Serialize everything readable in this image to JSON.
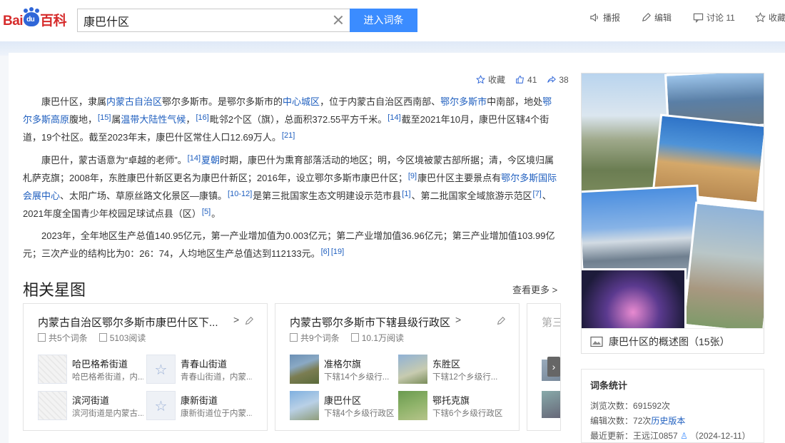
{
  "header": {
    "logo": {
      "bai": "Bai",
      "du": "du",
      "baike": "百科"
    },
    "search_value": "康巴什区",
    "enter_label": "进入词条",
    "tools": [
      {
        "label": "播报",
        "icon": "speaker-icon"
      },
      {
        "label": "编辑",
        "icon": "pencil-icon"
      },
      {
        "label": "讨论 11",
        "icon": "comment-icon"
      },
      {
        "label": "收藏",
        "icon": "star-icon"
      }
    ]
  },
  "actions": {
    "collect": "收藏",
    "likes": "41",
    "shares": "38"
  },
  "article": {
    "p1": [
      {
        "t": "康巴什区，隶属"
      },
      {
        "t": "内蒙古自治区",
        "link": true
      },
      {
        "t": "鄂尔多斯市。是鄂尔多斯市的"
      },
      {
        "t": "中心城区",
        "link": true
      },
      {
        "t": "，位于内蒙古自治区西南部、"
      },
      {
        "t": "鄂尔多斯市",
        "link": true
      },
      {
        "t": "中南部，地处"
      },
      {
        "t": "鄂尔多斯高原",
        "link": true
      },
      {
        "t": "腹地，"
      },
      {
        "t": "[15]",
        "sup": true
      },
      {
        "t": "属"
      },
      {
        "t": "温带大陆性气候",
        "link": true
      },
      {
        "t": "，"
      },
      {
        "t": "[16]",
        "sup": true
      },
      {
        "t": "毗邻2个区（旗），总面积372.55平方千米。"
      },
      {
        "t": "[14]",
        "sup": true
      },
      {
        "t": "截至2021年10月，康巴什区辖4个街道，19个社区。截至2023年末，康巴什区常住人口12.69万人。"
      },
      {
        "t": "[21]",
        "sup": true
      }
    ],
    "p2": [
      {
        "t": "康巴什，蒙古语意为“卓越的老师”。"
      },
      {
        "t": "[14]",
        "sup": true
      },
      {
        "t": "夏朝",
        "link": true
      },
      {
        "t": "时期，康巴什为熏育部落活动的地区；明，今区境被蒙古部所据；清，今区境归属札萨克旗；2008年，东胜康巴什新区更名为康巴什新区；2016年，设立鄂尔多斯市康巴什区；"
      },
      {
        "t": "[9]",
        "sup": true
      },
      {
        "t": "康巴什区主要景点有"
      },
      {
        "t": "鄂尔多斯国际会展中心",
        "link": true
      },
      {
        "t": "、太阳广场、草原丝路文化景区—康镇。"
      },
      {
        "t": "[10-12]",
        "sup": true
      },
      {
        "t": "是第三批国家生态文明建设示范市县"
      },
      {
        "t": "[1]",
        "sup": true
      },
      {
        "t": "、第二批国家全域旅游示范区"
      },
      {
        "t": "[7]",
        "sup": true
      },
      {
        "t": "、2021年度全国青少年校园足球试点县（区）"
      },
      {
        "t": "[5]",
        "sup": true
      },
      {
        "t": "。"
      }
    ],
    "p3": [
      {
        "t": "2023年，全年地区生产总值140.95亿元，第一产业增加值为0.003亿元；第二产业增加值36.96亿元；第三产业增加值103.99亿元；三次产业的结构比为0：26：74，人均地区生产总值达到112133元。"
      },
      {
        "t": "[6]",
        "sup": true
      },
      {
        "t": "[19]",
        "sup": true
      }
    ]
  },
  "related": {
    "title": "相关星图",
    "more": "查看更多",
    "cards": [
      {
        "title": "内蒙古自治区鄂尔多斯市康巴什区下...",
        "entries": "共5个词条",
        "reads": "5103阅读",
        "items": [
          {
            "name": "哈巴格希街道",
            "desc": "哈巴格希街道，内...",
            "thumb": "map"
          },
          {
            "name": "青春山街道",
            "desc": "青春山街道，内蒙...",
            "thumb": "star"
          },
          {
            "name": "滨河街道",
            "desc": "滨河街道是内蒙古...",
            "thumb": "map"
          },
          {
            "name": "康新街道",
            "desc": "康新街道位于内蒙...",
            "thumb": "star"
          }
        ]
      },
      {
        "title": "内蒙古鄂尔多斯市下辖县级行政区",
        "entries": "共9个词条",
        "reads": "10.1万阅读",
        "items": [
          {
            "name": "准格尔旗",
            "desc": "下辖14个乡级行...",
            "thumb": "photo"
          },
          {
            "name": "东胜区",
            "desc": "下辖12个乡级行...",
            "thumb": "photo"
          },
          {
            "name": "康巴什区",
            "desc": "下辖4个乡级行政区",
            "thumb": "photo"
          },
          {
            "name": "鄂托克旗",
            "desc": "下辖6个乡级行政区",
            "thumb": "photo"
          }
        ]
      },
      {
        "title": "第三",
        "entries": "",
        "reads": ""
      }
    ]
  },
  "album": {
    "caption": "康巴什区的概述图（15张）"
  },
  "stats": {
    "title": "词条统计",
    "views_label": "浏览次数：",
    "views": "691592次",
    "edits_label": "编辑次数：",
    "edits": "72次",
    "history": "历史版本",
    "updated_label": "最近更新：",
    "updated_by": "王远江0857",
    "updated_date": "（2024-12-11）"
  }
}
